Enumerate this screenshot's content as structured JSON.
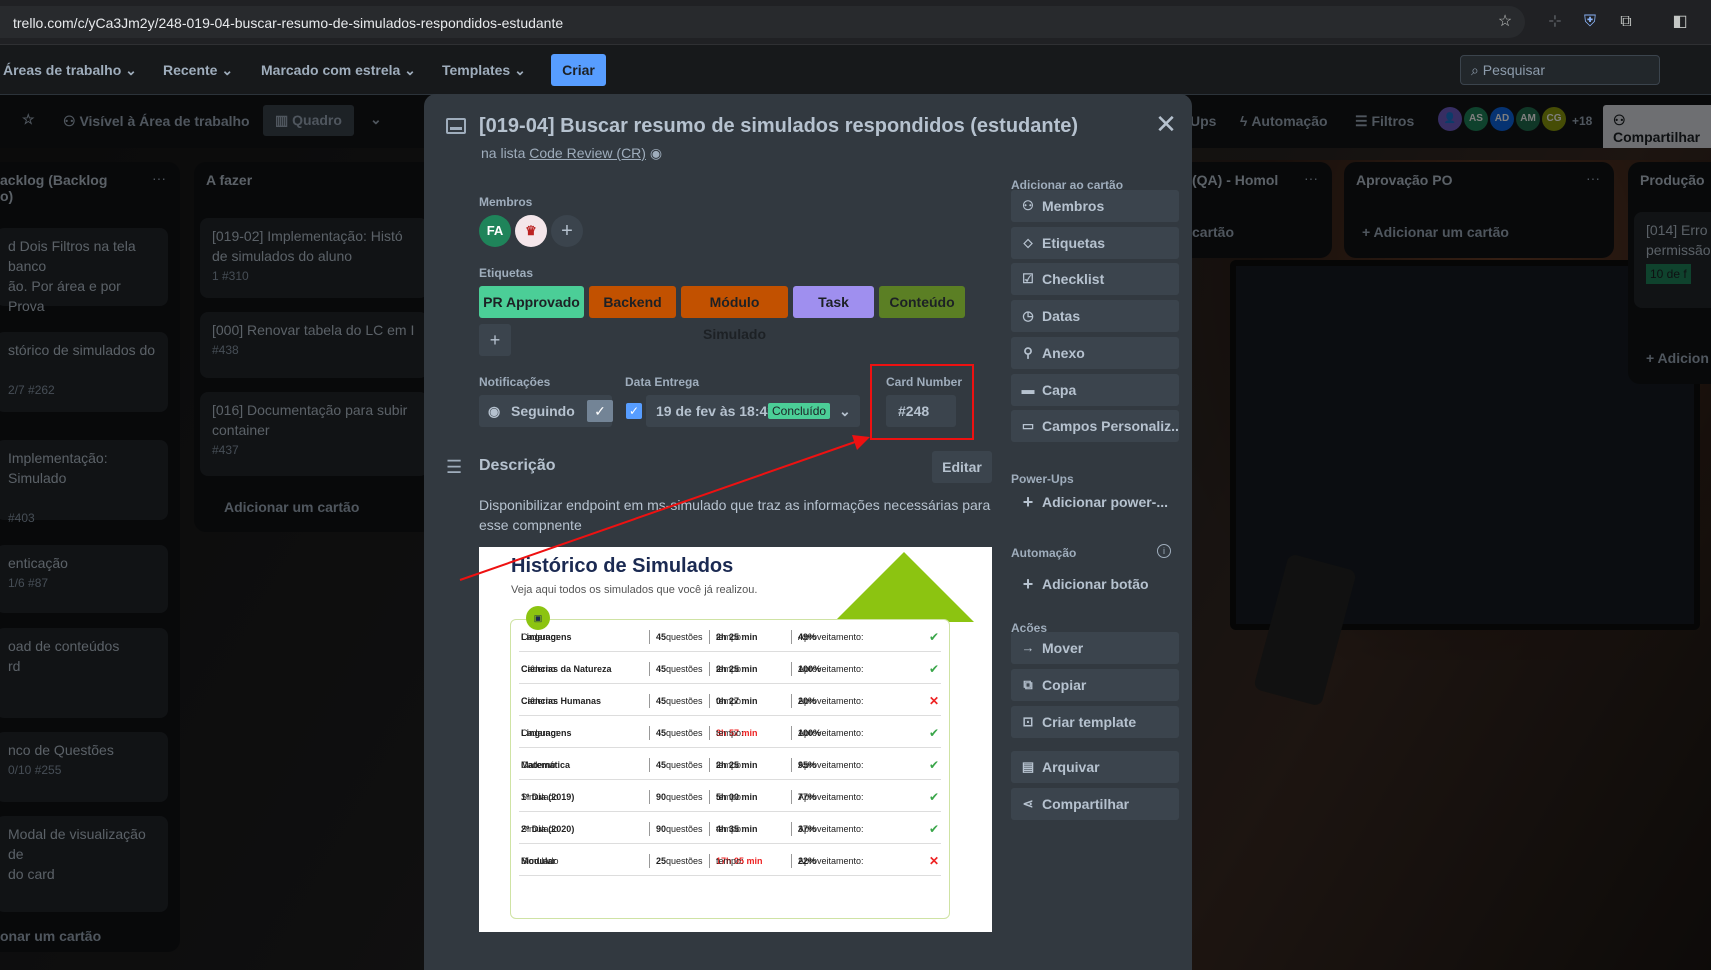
{
  "browser": {
    "url": "trello.com/c/yCa3Jm2y/248-019-04-buscar-resumo-de-simulados-respondidos-estudante"
  },
  "topnav": {
    "workspaces": "Áreas de trabalho",
    "recent": "Recente",
    "starred": "Marcado com estrela",
    "templates": "Templates",
    "create": "Criar",
    "search_placeholder": "Pesquisar"
  },
  "boardbar": {
    "visibility": "Visível à Área de trabalho",
    "view": "Quadro",
    "powerups": "Ups",
    "automation": "Automação",
    "filters": "Filtros",
    "members": [
      "AS",
      "AD",
      "AM",
      "CG"
    ],
    "more_members": "+18",
    "share": "Compartilhar"
  },
  "lists": {
    "backlog": {
      "title": "acklog (Backlog",
      "title2": "o)",
      "cards": [
        {
          "text": "d Dois Filtros na tela banco",
          "text2": "ão. Por área e por Prova",
          "meta": ""
        },
        {
          "text": "stórico de simulados do",
          "text2": "",
          "meta": "2/7    #262"
        },
        {
          "text": "Implementação: Simulado",
          "text2": "",
          "meta": "   #403"
        },
        {
          "text": "enticação",
          "text2": "",
          "meta": "1/6    #87"
        },
        {
          "text": "oad de conteúdos",
          "text2": "rd",
          "meta": ""
        },
        {
          "text": "nco de Questões",
          "text2": "",
          "meta": "0/10    #255"
        },
        {
          "text": "Modal de visualização de",
          "text2": "do card",
          "meta": ""
        }
      ],
      "add": "onar um cartão"
    },
    "afazer": {
      "title": "A fazer",
      "cards": [
        {
          "text": "[019-02] Implementação: Histó",
          "text2": "de simulados do aluno",
          "meta": "1    #310"
        },
        {
          "text": "[000] Renovar tabela do LC em I",
          "text2": "",
          "meta": "#438"
        },
        {
          "text": "[016] Documentação para subir",
          "text2": "container",
          "meta": "#437"
        }
      ],
      "add": "Adicionar um cartão"
    },
    "qa": {
      "title": "(QA) - Homol",
      "add": "cartão"
    },
    "aprovacao": {
      "title": "Aprovação PO",
      "add": "Adicionar um cartão"
    },
    "producao": {
      "title": "Produção",
      "card": "[014] Erro",
      "card2": "permissão",
      "badge": "10 de f",
      "add": "Adicion"
    }
  },
  "modal": {
    "title": "[019-04] Buscar resumo de simulados respondidos (estudante)",
    "list_prefix": "na lista",
    "list_name": "Code Review (CR)",
    "members_label": "Membros",
    "member_initials": "FA",
    "labels_label": "Etiquetas",
    "labels": [
      {
        "text": "PR Approvado",
        "color": "#4bce97"
      },
      {
        "text": "Backend",
        "color": "#c25100"
      },
      {
        "text": "Módulo Simulado",
        "color": "#c25100"
      },
      {
        "text": "Task",
        "color": "#9f8fef"
      },
      {
        "text": "Conteúdo",
        "color": "#5b7f24"
      }
    ],
    "notifications_label": "Notificações",
    "notifications_value": "Seguindo",
    "due_label": "Data Entrega",
    "due_value": "19 de fev às 18:43",
    "due_badge": "Concluído",
    "card_number_label": "Card Number",
    "card_number_value": "#248",
    "description_label": "Descrição",
    "edit": "Editar",
    "description": "Disponibilizar endpoint em ms-simulado que traz as informações necessárias para esse compnente"
  },
  "embedded_image": {
    "title": "Histórico de Simulados",
    "subtitle": "Veja aqui todos os simulados que você já realizou.",
    "rows": [
      {
        "prefix": "Caderno:",
        "name": "Linguagens",
        "qnum": "45",
        "qlabel": "questões",
        "tlabel": "tempo:",
        "time": "2h 25 min",
        "alabel": "Aproveitamento:",
        "score": "49%",
        "ok": true,
        "late": false
      },
      {
        "prefix": "Caderno",
        "name": "Ciências da Natureza",
        "qnum": "45",
        "qlabel": "questões",
        "tlabel": "tempo:",
        "time": "2h 25 min",
        "alabel": "Aproveitamento:",
        "score": "100%",
        "ok": true,
        "late": false
      },
      {
        "prefix": "Caderno:",
        "name": "Ciências Humanas",
        "qnum": "45",
        "qlabel": "questões",
        "tlabel": "tempo:",
        "time": "0h 27 min",
        "alabel": "Aproveitamento:",
        "score": "20%",
        "ok": false,
        "late": false
      },
      {
        "prefix": "Caderno:",
        "name": "Linguagens",
        "qnum": "45",
        "qlabel": "questões",
        "tlabel": "tempo:",
        "time": "3h 57 min",
        "alabel": "Aproveitamento:",
        "score": "100%",
        "ok": true,
        "late": true
      },
      {
        "prefix": "Caderno:",
        "name": "Matemática",
        "qnum": "45",
        "qlabel": "questões",
        "tlabel": "tempo:",
        "time": "2h 25 min",
        "alabel": "Aproveitamento:",
        "score": "95%",
        "ok": true,
        "late": false
      },
      {
        "prefix": "Simulado",
        "name": "1º Dia (2019)",
        "qnum": "90",
        "qlabel": "questões",
        "tlabel": "tempo:",
        "time": "5h 00 min",
        "alabel": "Aproveitamento:",
        "score": "77%",
        "ok": true,
        "late": false
      },
      {
        "prefix": "Simulado",
        "name": "2º Dia (2020)",
        "qnum": "90",
        "qlabel": "questões",
        "tlabel": "tempo:",
        "time": "4h 35 min",
        "alabel": "Aproveitamento:",
        "score": "37%",
        "ok": true,
        "late": false
      },
      {
        "prefix": "Simulado",
        "name": "Modular",
        "qnum": "25",
        "qlabel": "questões",
        "tlabel": "tempo:",
        "time": "17h 05 min",
        "alabel": "Aproveitamento:",
        "score": "22%",
        "ok": false,
        "late": true
      }
    ]
  },
  "sidebar": {
    "add_to_card": "Adicionar ao cartão",
    "add_items": [
      "Membros",
      "Etiquetas",
      "Checklist",
      "Datas",
      "Anexo",
      "Capa",
      "Campos Personaliz..."
    ],
    "powerups_label": "Power-Ups",
    "add_powerup": "Adicionar power-...",
    "automation_label": "Automação",
    "add_button": "Adicionar botão",
    "actions_label": "Ações",
    "actions": [
      "Mover",
      "Copiar",
      "Criar template",
      "Arquivar",
      "Compartilhar"
    ]
  }
}
